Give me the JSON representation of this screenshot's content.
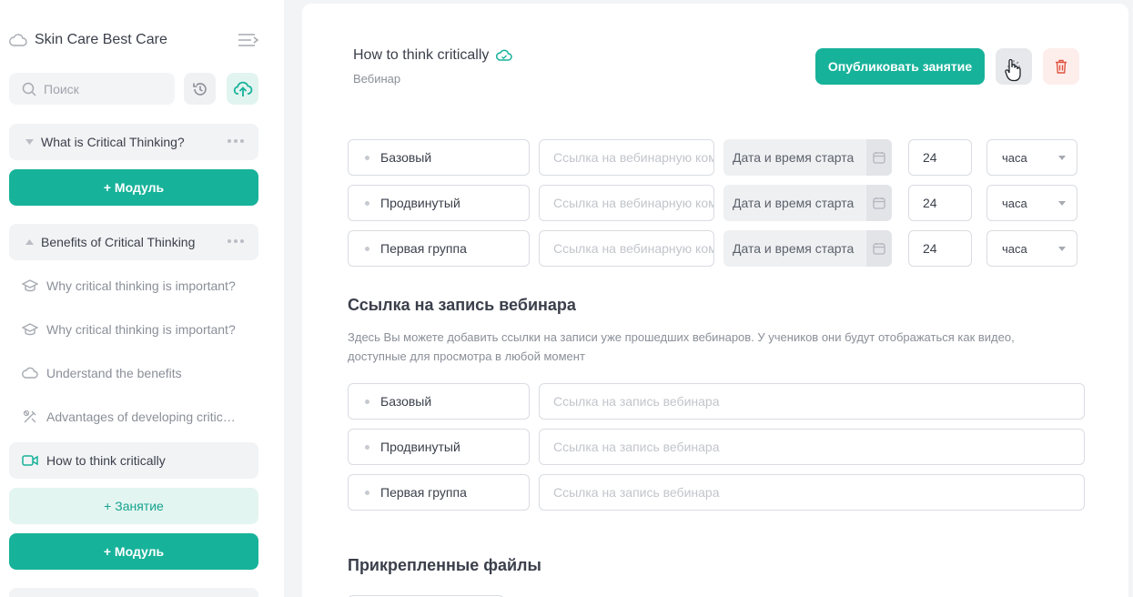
{
  "sidebar": {
    "course_title": "Skin Care Best Care",
    "search_placeholder": "Поиск",
    "modules": [
      {
        "title": "What is Critical Thinking?",
        "expanded": false
      },
      {
        "title": "Benefits of Critical Thinking",
        "expanded": true
      }
    ],
    "lessons": [
      {
        "title": "Why critical thinking is important?",
        "icon": "graduation-cap-icon"
      },
      {
        "title": "Why critical thinking is important?",
        "icon": "graduation-cap-icon"
      },
      {
        "title": "Understand the benefits",
        "icon": "cloud-icon"
      },
      {
        "title": "Advantages of developing critic…",
        "icon": "tools-icon"
      },
      {
        "title": "How to think critically",
        "icon": "video-camera-icon",
        "active": true
      }
    ],
    "add_module_label": "+ Модуль",
    "add_lesson_label": "+ Занятие"
  },
  "header": {
    "lesson_title": "How to think critically",
    "lesson_type": "Вебинар",
    "publish_label": "Опубликовать занятие"
  },
  "webinar_schedule": {
    "link_placeholder": "Ссылка на вебинарную комнату",
    "date_placeholder": "Дата и время старта",
    "rows": [
      {
        "group": "Базовый",
        "hours": "24",
        "unit": "часа"
      },
      {
        "group": "Продвинутый",
        "hours": "24",
        "unit": "часа"
      },
      {
        "group": "Первая группа",
        "hours": "24",
        "unit": "часа"
      }
    ]
  },
  "recording": {
    "title": "Ссылка на запись вебинара",
    "description": "Здесь Вы можете добавить ссылки на записи уже прошедших вебинаров. У учеников они будут отображаться как видео, доступные для просмотра в любой момент",
    "placeholder": "Ссылка на запись вебинара",
    "groups": [
      "Базовый",
      "Продвинутый",
      "Первая группа"
    ]
  },
  "attachments": {
    "title": "Прикрепленные файлы"
  },
  "colors": {
    "accent": "#17b29a",
    "accent_light": "#e3f5f1",
    "danger": "#e0533f",
    "danger_light": "#fdeeec"
  }
}
